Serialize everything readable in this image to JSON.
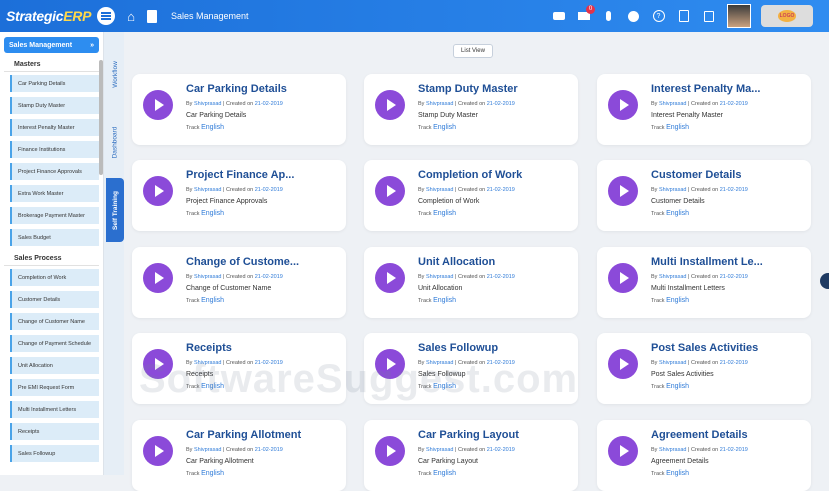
{
  "topbar": {
    "logo_main": "Strategic",
    "logo_erp": "ERP",
    "page_title": "Sales Management",
    "notification_count": "0",
    "brand_logo": "LOGO"
  },
  "sidebar": {
    "header": "Sales Management",
    "header_icon": "»",
    "sections": [
      {
        "title": "Masters",
        "items": [
          "Car Parking Details",
          "Stamp Duty Master",
          "Interest Penalty Master",
          "Finance Institutions",
          "Project Finance Approvals",
          "Extra Work Master",
          "Brokerage Payment Master",
          "Sales Budget"
        ]
      },
      {
        "title": "Sales Process",
        "items": [
          "Completion of Work",
          "Customer Details",
          "Change of Customer Name",
          "Change of Payment Schedule",
          "Unit Allocation",
          "Pre EMI Request Form",
          "Multi Installment Letters",
          "Receipts",
          "Sales Followup"
        ]
      }
    ]
  },
  "vtabs": [
    "Workflow",
    "Dashboard",
    "Self Training"
  ],
  "list_view_label": "List View",
  "card_meta": {
    "by": "By",
    "author": "Shivprasad",
    "sep": "| Created on",
    "date": "21-02-2019",
    "track": "Track",
    "lang": "English"
  },
  "cards": [
    {
      "title": "Car Parking Details",
      "desc": "Car Parking Details"
    },
    {
      "title": "Stamp Duty Master",
      "desc": "Stamp Duty Master"
    },
    {
      "title": "Interest Penalty Ma...",
      "desc": "Interest Penalty Master"
    },
    {
      "title": "Project Finance Ap...",
      "desc": "Project Finance Approvals"
    },
    {
      "title": "Completion of Work",
      "desc": "Completion of Work"
    },
    {
      "title": "Customer Details",
      "desc": "Customer Details"
    },
    {
      "title": "Change of Custome...",
      "desc": "Change of Customer Name"
    },
    {
      "title": "Unit Allocation",
      "desc": "Unit Allocation"
    },
    {
      "title": "Multi Installment Le...",
      "desc": "Multi Installment Letters"
    },
    {
      "title": "Receipts",
      "desc": "Receipts"
    },
    {
      "title": "Sales Followup",
      "desc": "Sales Followup"
    },
    {
      "title": "Post Sales Activities",
      "desc": "Post Sales Activities"
    },
    {
      "title": "Car Parking Allotment",
      "desc": "Car Parking Allotment"
    },
    {
      "title": "Car Parking Layout",
      "desc": "Car Parking Layout"
    },
    {
      "title": "Agreement Details",
      "desc": "Agreement Details"
    }
  ],
  "watermark": "SoftwareSuggest.com",
  "colors": {
    "topbar": "#1c6fd9",
    "accent": "#2d8df0",
    "play": "#8b4ad9",
    "title": "#1f4f96"
  }
}
